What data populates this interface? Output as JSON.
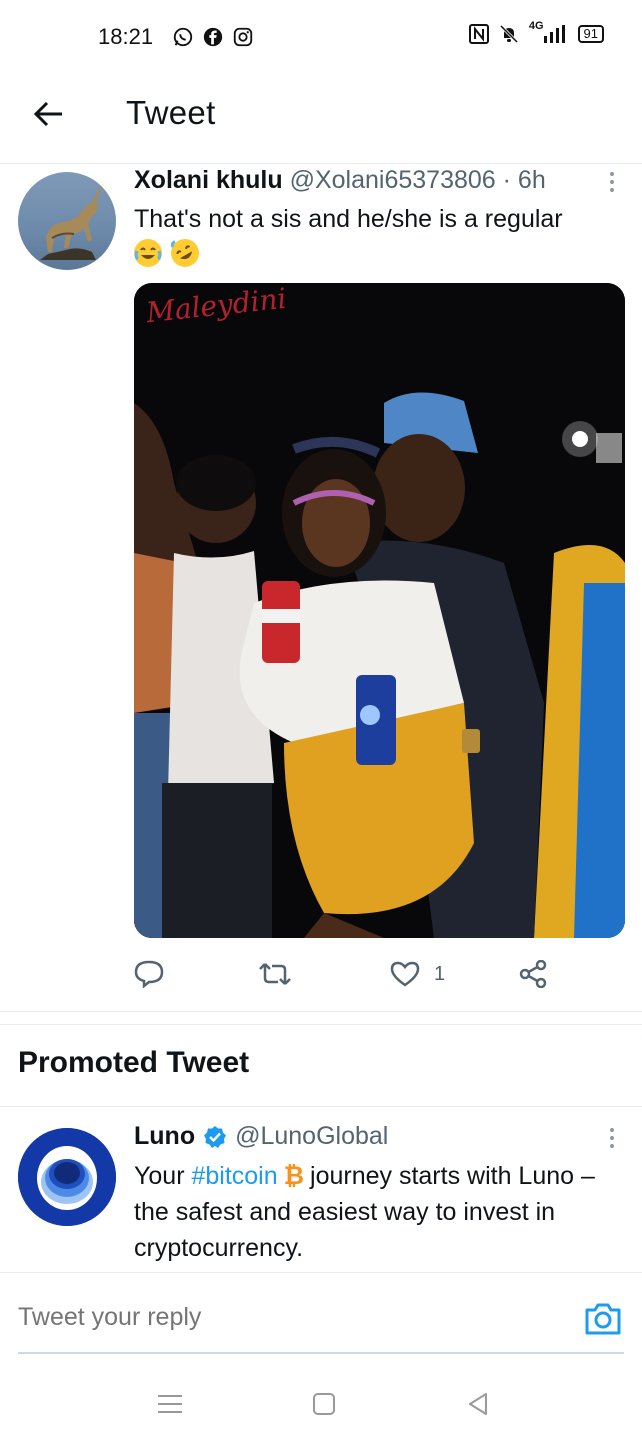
{
  "status": {
    "time": "18:21",
    "network": "4G",
    "battery": "91",
    "battery_level": 0.91
  },
  "header": {
    "title": "Tweet"
  },
  "tweet": {
    "name": "Xolani khulu",
    "handle": "@Xolani65373806",
    "separator": "·",
    "time": "6h",
    "text": "That's not a sis and he/she is a regular",
    "emojis": [
      "face-with-tears-of-joy",
      "rolling-on-the-floor-laughing"
    ],
    "photo_watermark": "Maleydini",
    "actions": {
      "reply_count": "",
      "retweet_count": "",
      "like_count": "1"
    }
  },
  "promoted": {
    "title": "Promoted Tweet",
    "name": "Luno",
    "handle": "@LunoGlobal",
    "text_before": "Your ",
    "hashtag": "#bitcoin",
    "btc_symbol": "₿",
    "text_after": "journey starts with Luno – the safest and easiest way to invest in cryptocurrency."
  },
  "reply": {
    "placeholder": "Tweet your reply"
  },
  "colors": {
    "accent": "#1d9bf0",
    "text_primary": "#0f1419",
    "text_secondary": "#536471",
    "divider": "#e6ecf0",
    "luno_blue": "#1339a8",
    "bitcoin_orange": "#f7931a"
  },
  "icons": {
    "back": "arrow-left-icon",
    "more": "more-vertical-icon",
    "reply": "reply-bubble-icon",
    "retweet": "retweet-icon",
    "like": "heart-icon",
    "share": "share-icon",
    "verified": "verified-badge-icon",
    "camera": "camera-icon",
    "nav_menu": "recent-apps-icon",
    "nav_home": "home-square-icon",
    "nav_back": "back-triangle-icon"
  }
}
